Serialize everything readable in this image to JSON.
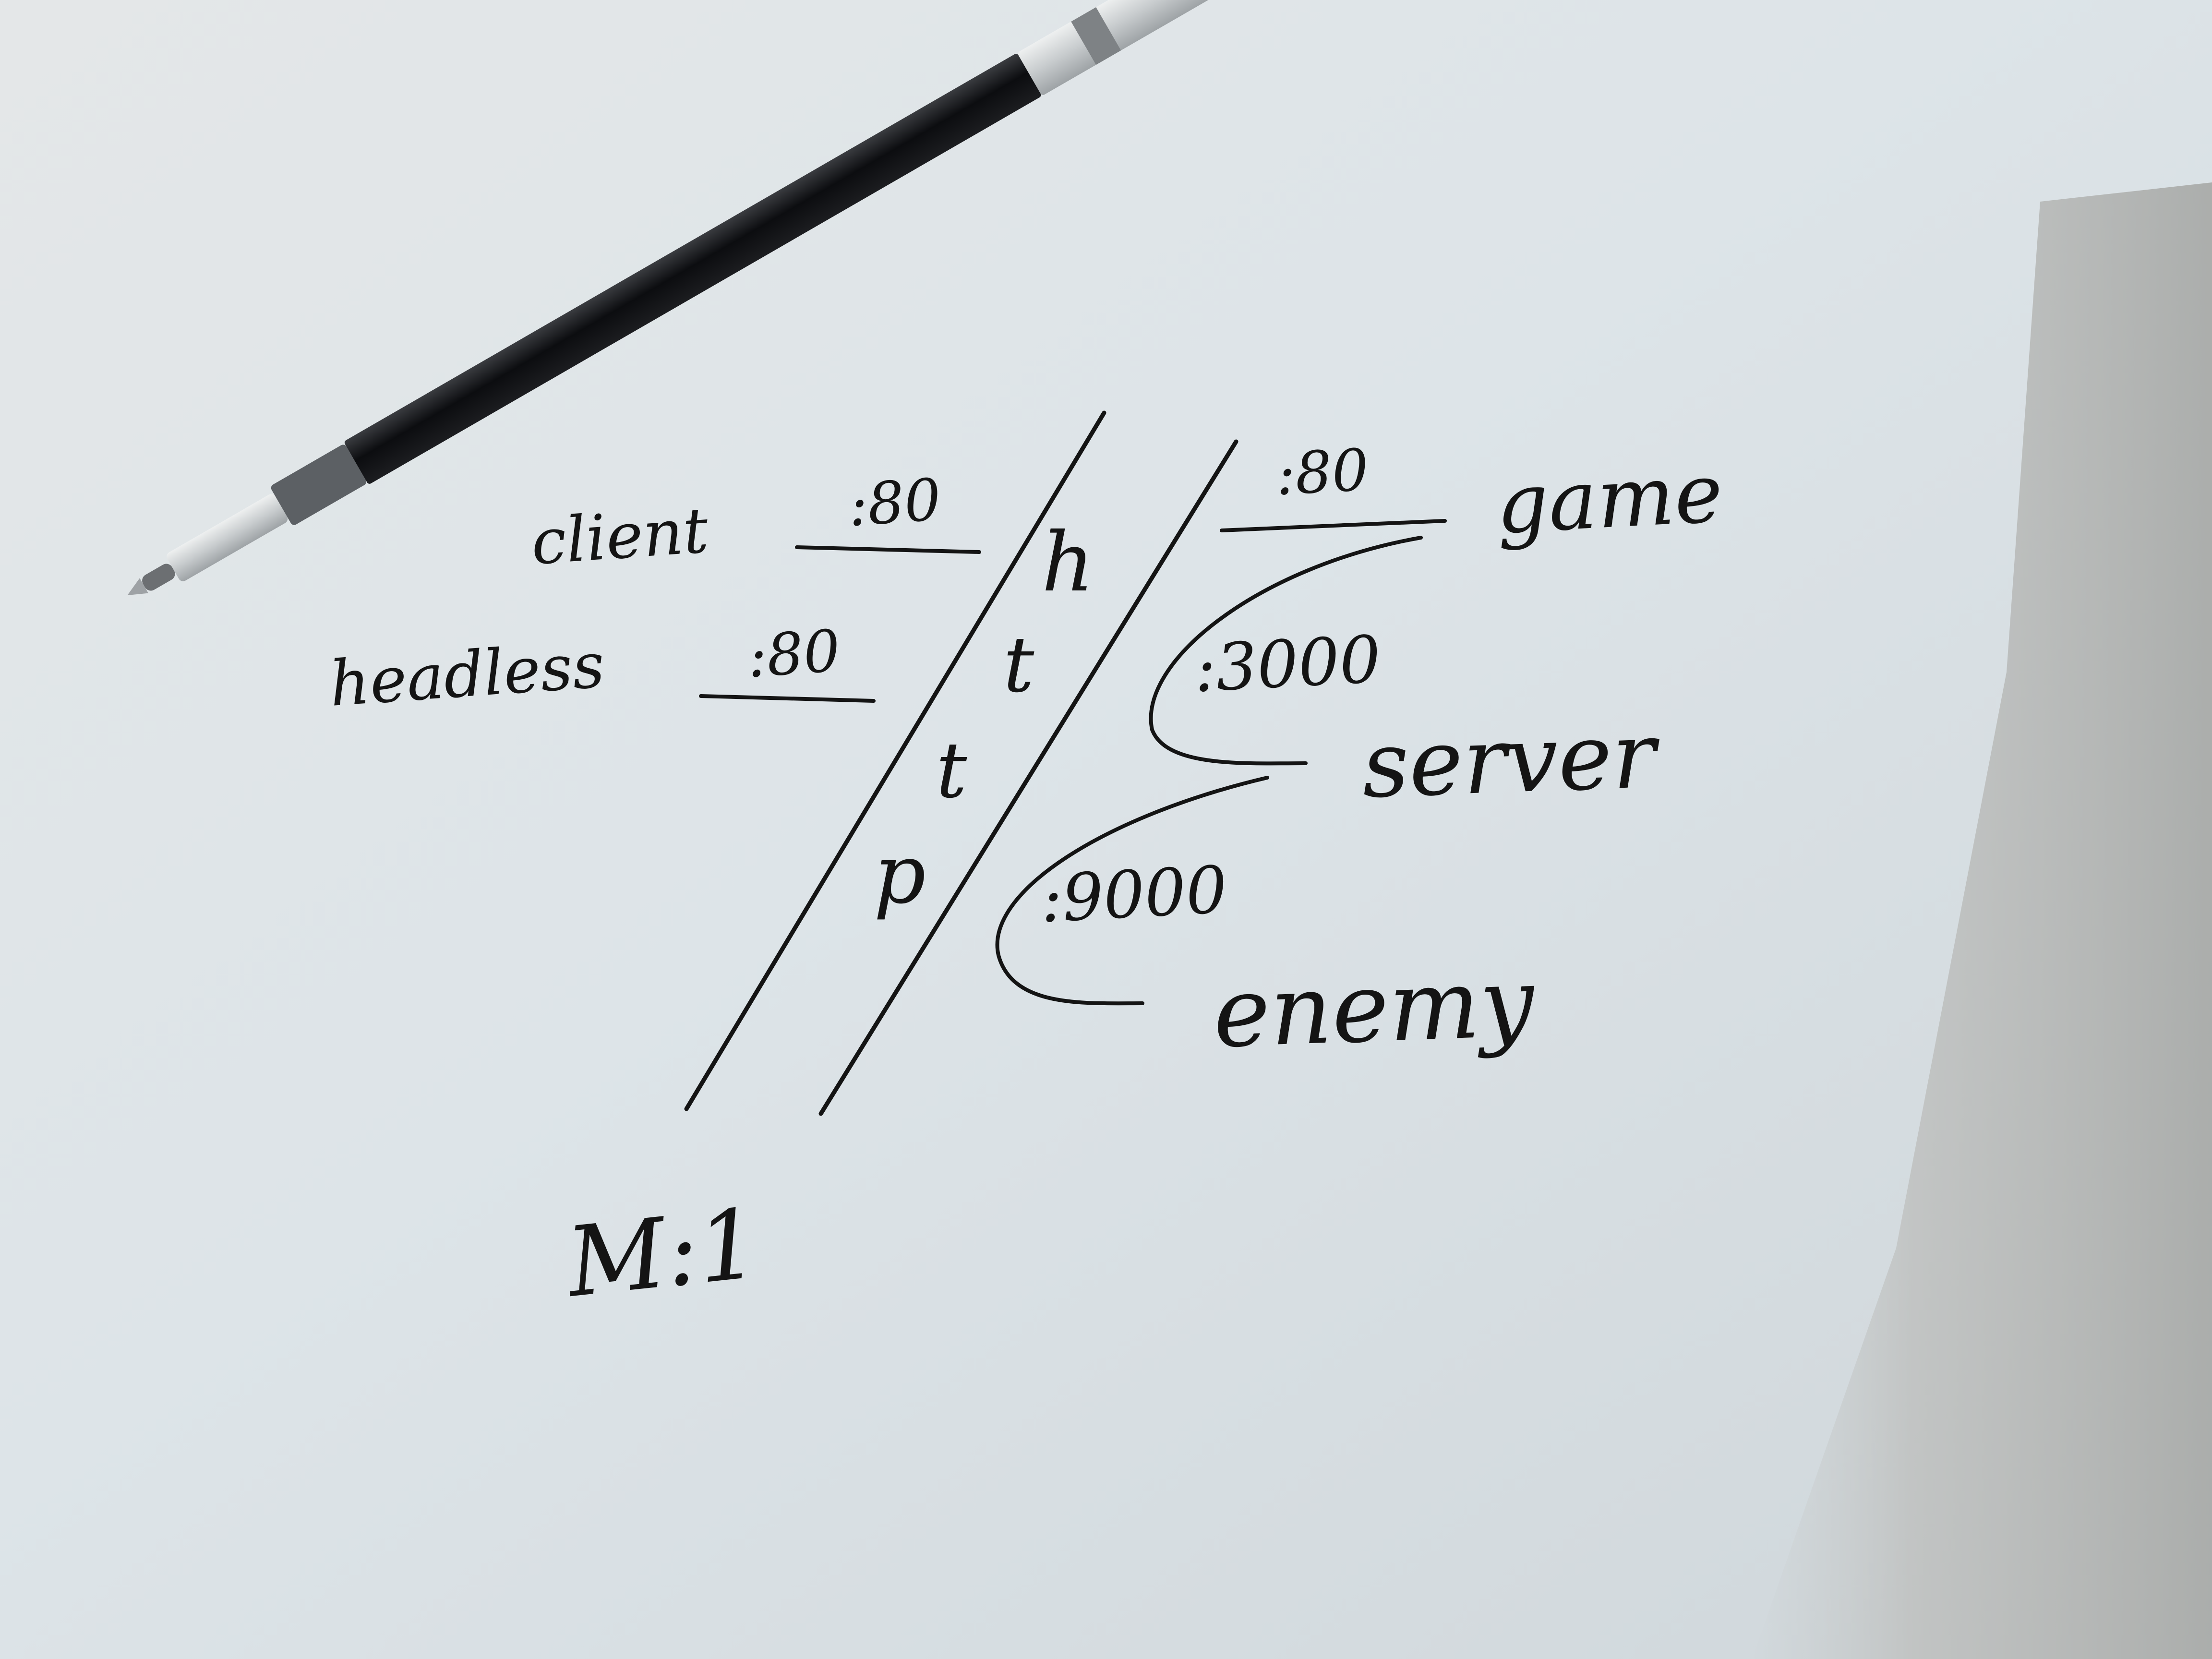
{
  "diagram": {
    "left_labels": {
      "client": "client",
      "client_port": ":80",
      "headless": "headless",
      "headless_port": ":80"
    },
    "protocol_letters": [
      "h",
      "t",
      "t",
      "p"
    ],
    "right_labels": {
      "game_port": ":80",
      "game": "game",
      "server_port": ":3000",
      "server": "server",
      "enemy_port": ":9000",
      "enemy": "enemy"
    },
    "ratio": "M:1"
  },
  "scene": {
    "pen_icon": "ballpoint-pen-refill-icon",
    "paper_color": "#dfe6ea",
    "ink_color": "#141414",
    "shadow_color": "#b9bcbe"
  }
}
